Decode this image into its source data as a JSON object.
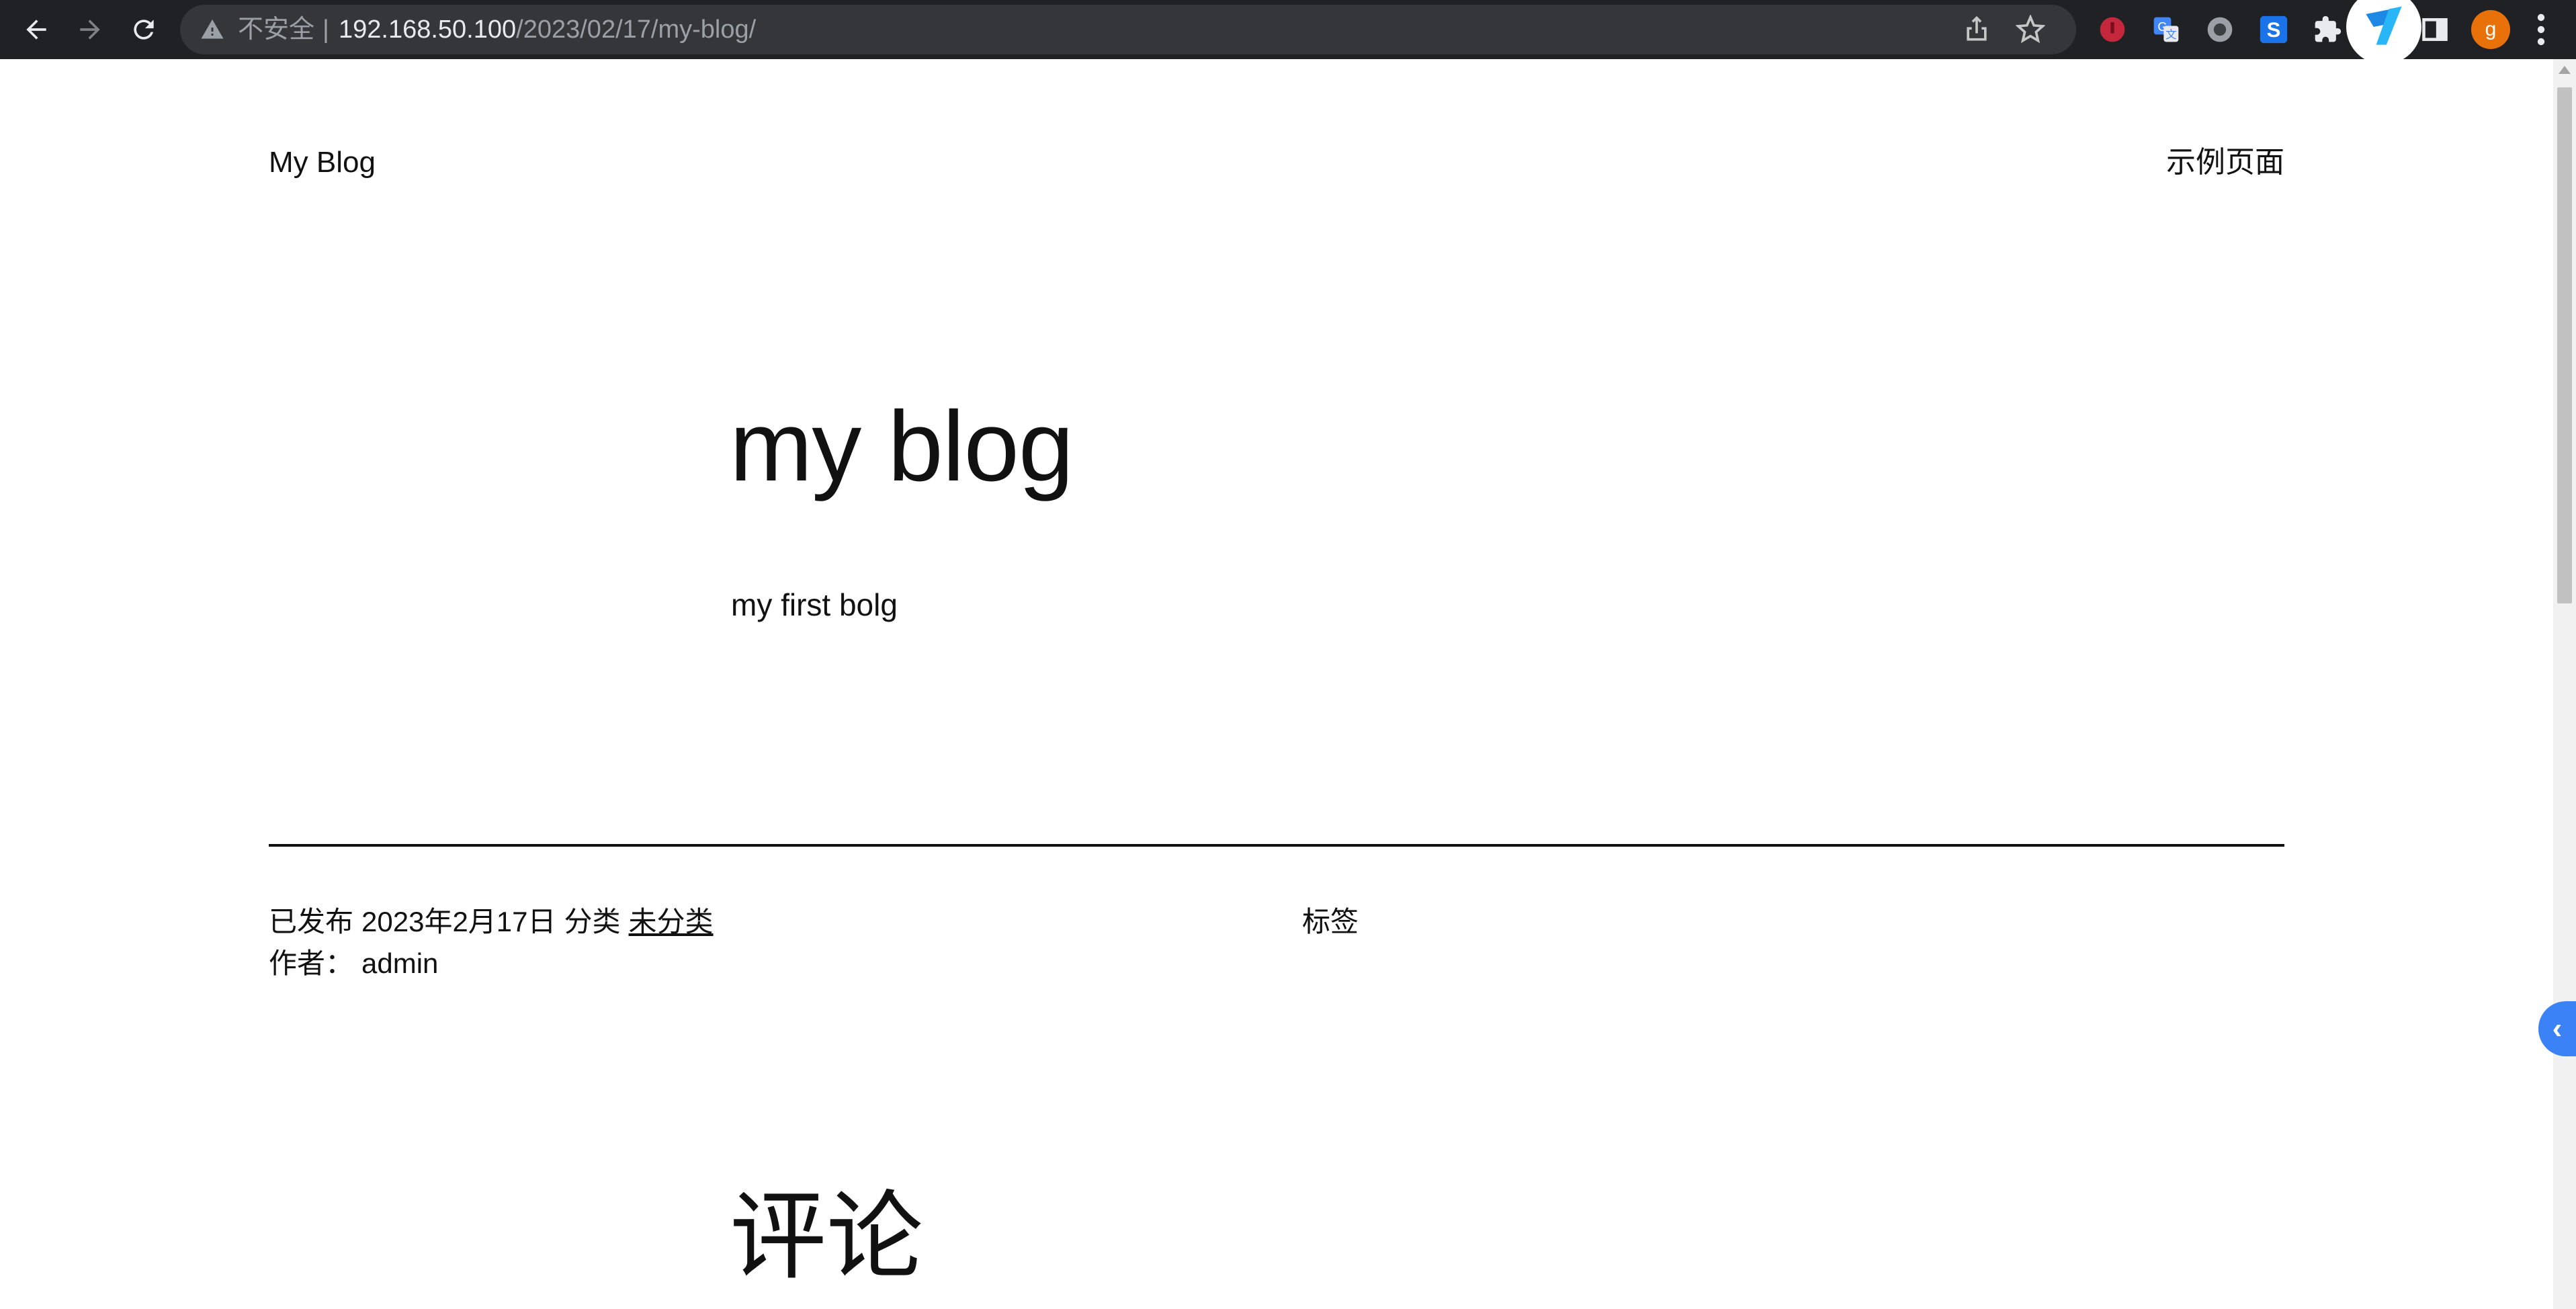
{
  "browser": {
    "not_secure_label": "不安全",
    "separator": "|",
    "url_host": "192.168.50.100",
    "url_path": "/2023/02/17/my-blog/",
    "avatar_letter": "g",
    "toolbar_color": "#202124",
    "avatar_color": "#e8710a"
  },
  "site": {
    "title": "My Blog",
    "nav_page": "示例页面"
  },
  "post": {
    "title": "my blog",
    "body": "my first bolg",
    "published_label": "已发布",
    "date": "2023年2月17日",
    "category_label": "分类",
    "category": "未分类",
    "author_label": "作者：",
    "author": "admin",
    "tags_label": "标签"
  },
  "comments": {
    "title": "评论"
  },
  "side_tab": {
    "glyph": "‹",
    "color": "#3b82f6"
  }
}
